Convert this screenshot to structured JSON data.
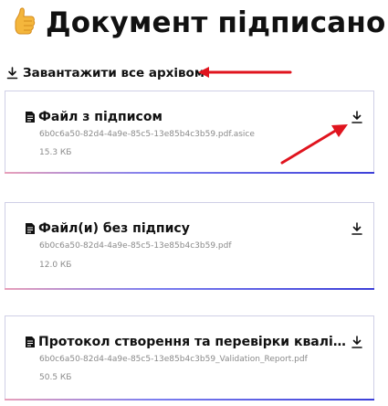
{
  "page": {
    "title": "Документ підписано",
    "title_icon": "thumbs-up-icon"
  },
  "download_all": {
    "label": "Завантажити все архівом",
    "icon": "download-icon"
  },
  "files": [
    {
      "title": "Файл з підписом",
      "filename": "6b0c6a50-82d4-4a9e-85c5-13e85b4c3b59.pdf.asice",
      "size": "15.3 КБ",
      "icon": "document-icon",
      "action_icon": "download-icon"
    },
    {
      "title": "Файл(и) без підпису",
      "filename": "6b0c6a50-82d4-4a9e-85c5-13e85b4c3b59.pdf",
      "size": "12.0 КБ",
      "icon": "document-icon",
      "action_icon": "download-icon"
    },
    {
      "title": "Протокол створення та перевірки кваліфіко...",
      "filename": "6b0c6a50-82d4-4a9e-85c5-13e85b4c3b59_Validation_Report.pdf",
      "size": "50.5 КБ",
      "icon": "document-icon",
      "action_icon": "download-icon"
    }
  ],
  "colors": {
    "annotation_arrow": "#e0141e",
    "card_border": "#cfcfe6",
    "card_bottom_accent": "#3c3fd8",
    "secondary_text": "#8a8a8a"
  }
}
